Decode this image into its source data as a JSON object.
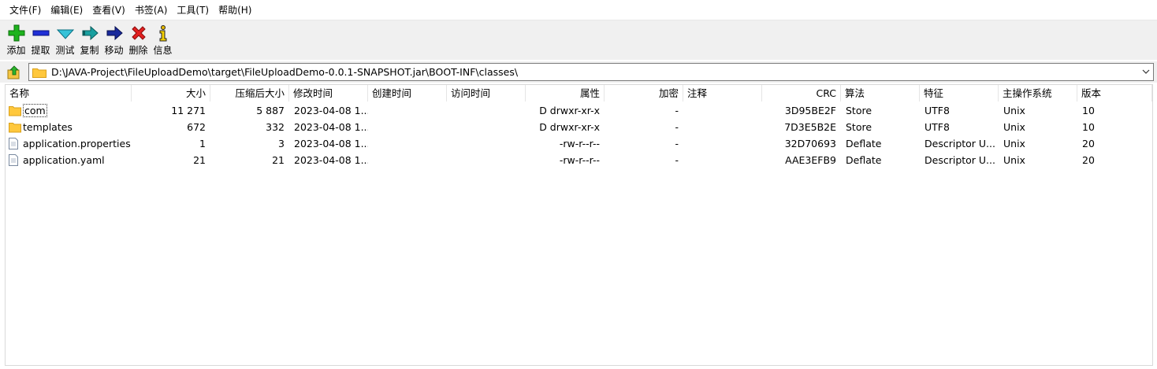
{
  "menu": [
    {
      "label": "文件(F)",
      "name": "menu-file"
    },
    {
      "label": "编辑(E)",
      "name": "menu-edit"
    },
    {
      "label": "查看(V)",
      "name": "menu-view"
    },
    {
      "label": "书签(A)",
      "name": "menu-bookmarks"
    },
    {
      "label": "工具(T)",
      "name": "menu-tools"
    },
    {
      "label": "帮助(H)",
      "name": "menu-help"
    }
  ],
  "toolbar": {
    "add_label": "添加",
    "extract_label": "提取",
    "test_label": "测试",
    "copy_label": "复制",
    "move_label": "移动",
    "delete_label": "删除",
    "info_label": "信息"
  },
  "address": {
    "path": "D:\\JAVA-Project\\FileUploadDemo\\target\\FileUploadDemo-0.0.1-SNAPSHOT.jar\\BOOT-INF\\classes\\"
  },
  "columns": {
    "name": "名称",
    "size": "大小",
    "packed": "压缩后大小",
    "modified": "修改时间",
    "created": "创建时间",
    "accessed": "访问时间",
    "attributes": "属性",
    "encrypted": "加密",
    "comment": "注释",
    "crc": "CRC",
    "method": "算法",
    "characteristics": "特征",
    "host_os": "主操作系统",
    "version": "版本"
  },
  "files": [
    {
      "name": "com",
      "type": "folder",
      "size": "11 271",
      "packed": "5 887",
      "modified": "2023-04-08 1...",
      "created": "",
      "accessed": "",
      "attributes": "D drwxr-xr-x",
      "encrypted": "-",
      "comment": "",
      "crc": "3D95BE2F",
      "method": "Store",
      "characteristics": "UTF8",
      "host_os": "Unix",
      "version": "10"
    },
    {
      "name": "templates",
      "type": "folder",
      "size": "672",
      "packed": "332",
      "modified": "2023-04-08 1...",
      "created": "",
      "accessed": "",
      "attributes": "D drwxr-xr-x",
      "encrypted": "-",
      "comment": "",
      "crc": "7D3E5B2E",
      "method": "Store",
      "characteristics": "UTF8",
      "host_os": "Unix",
      "version": "10"
    },
    {
      "name": "application.properties",
      "type": "file",
      "size": "1",
      "packed": "3",
      "modified": "2023-04-08 1...",
      "created": "",
      "accessed": "",
      "attributes": "-rw-r--r--",
      "encrypted": "-",
      "comment": "",
      "crc": "32D70693",
      "method": "Deflate",
      "characteristics": "Descriptor U...",
      "host_os": "Unix",
      "version": "20"
    },
    {
      "name": "application.yaml",
      "type": "file",
      "size": "21",
      "packed": "21",
      "modified": "2023-04-08 1...",
      "created": "",
      "accessed": "",
      "attributes": "-rw-r--r--",
      "encrypted": "-",
      "comment": "",
      "crc": "AAE3EFB9",
      "method": "Deflate",
      "characteristics": "Descriptor U...",
      "host_os": "Unix",
      "version": "20"
    }
  ]
}
